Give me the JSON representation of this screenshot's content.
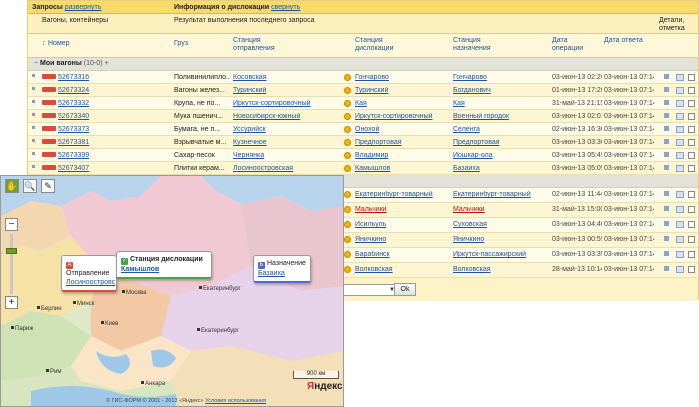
{
  "topbar": {
    "queries_label": "Запросы",
    "expand_link": "развернуть",
    "dislocation_label": "Информация о дислокации",
    "collapse_link": "свернуть"
  },
  "subbar": {
    "left_text": "Вагоны, контейнеры",
    "mid_text": "Результат выполнения последнего запроса",
    "right_text": "Детали, отметка"
  },
  "columns": {
    "number": "Номер",
    "cargo": "Груз",
    "departure_station": "Станция отправления",
    "dislocation_station": "Станция дислокации",
    "destination_station": "Станция назначения",
    "operation_date": "Дата операции",
    "answer_date": "Дата ответа"
  },
  "group": {
    "name": "Мои вагоны",
    "count": "(10-0)",
    "plus": "+"
  },
  "rows": [
    {
      "num": "52673316",
      "cargo": "Поливинилипло...",
      "from": "Косовская",
      "disl": "Гончарово",
      "to": "Гончарово",
      "op": "03-июн-13 02:26",
      "ans": "03-июн-13 07:14"
    },
    {
      "num": "52673324",
      "cargo": "Вагоны желез...",
      "from": "Туринский",
      "disl": "Туринский",
      "to": "Богданович",
      "op": "01-июн-13 17:20",
      "ans": "03-июн-13 07:14"
    },
    {
      "num": "52673332",
      "cargo": "Крупа, не по...",
      "from": "Иркутск-сортировочный",
      "disl": "Кая",
      "to": "Кая",
      "op": "31-май-13 21:15",
      "ans": "03-июн-13 07:14"
    },
    {
      "num": "52673340",
      "cargo": "Мука пшенич...",
      "from": "Новосибирск-южный",
      "disl": "Иркутск-сортировочный",
      "to": "Военный городок",
      "op": "03-июн-13 02:01",
      "ans": "03-июн-13 07:14"
    },
    {
      "num": "52673373",
      "cargo": "Бумага, не п...",
      "from": "Уссурийск",
      "disl": "Онохой",
      "to": "Селенга",
      "op": "02-июн-13 16:36",
      "ans": "03-июн-13 07:14"
    },
    {
      "num": "52673381",
      "cargo": "Взрывчатые м...",
      "from": "Кузнечное",
      "disl": "Предпортовая",
      "to": "Предпортовая",
      "op": "03-июн-13 03:36",
      "ans": "03-июн-13 07:14"
    },
    {
      "num": "52673399",
      "cargo": "Сахар-песок",
      "from": "Чернянка",
      "disl": "Владимир",
      "to": "Йошкар-ола",
      "op": "03-июн-13 05:49",
      "ans": "03-июн-13 07:14"
    },
    {
      "num": "52673407",
      "cargo": "Плитки керам...",
      "from": "Лосиноостровская",
      "disl": "Камышлов",
      "to": "Базаиха",
      "op": "03-июн-13 05:09",
      "ans": "03-июн-13 07:14"
    }
  ],
  "rows2": [
    {
      "disl": "Екатеринбург-товарный",
      "to": "Екатеринбург-товарный",
      "op": "02-июн-13 11:44",
      "ans": "03-июн-13 07:14",
      "red": false
    },
    {
      "disl": "Мальчики",
      "to": "Мальчики",
      "op": "31-май-13 15:00",
      "ans": "03-июн-13 07:14",
      "red": true
    },
    {
      "disl": "Исильуль",
      "to": "Суховская",
      "op": "03-июн-13 04:40",
      "ans": "03-июн-13 07:14",
      "red": false
    },
    {
      "disl": "Яничкино",
      "to": "Яничкино",
      "op": "03-июн-13 00:59",
      "ans": "03-июн-13 07:14",
      "red": false
    },
    {
      "disl": "Барабинск",
      "to": "Иркутск-пассажирский",
      "op": "03-июн-13 03:39",
      "ans": "03-июн-13 07:14",
      "red": false
    },
    {
      "disl": "Волковская",
      "to": "Волковская",
      "op": "28-май-13 10:14",
      "ans": "03-июн-13 07:14",
      "red": false
    }
  ],
  "bottom": {
    "ok_label": "Ok"
  },
  "map": {
    "balloon_from_title": "Отправление",
    "balloon_from_value": "Лосиноостровс",
    "balloon_disl_title": "Станция дислокации",
    "balloon_disl_value": "Камышлов",
    "balloon_to_title": "Назначение",
    "balloon_to_value": "Базаиха",
    "badge_a": "A",
    "badge_b": "Б",
    "cities": [
      "Москва",
      "Екатеринбург",
      "Екатеринбург",
      "Киев",
      "Минск",
      "Париж",
      "Рим",
      "Анкара",
      "Берлин"
    ],
    "scale": "900 км",
    "logo_a": "Я",
    "logo_b": "ндекс",
    "copyright": "© ГИС-ФОРМ © 2001 - 2013 «Яндекс»",
    "terms": "Условия использования"
  },
  "colors": {
    "accent": "#f6da6a",
    "panel": "#fdf3c6",
    "link": "#1d55a6",
    "wagon": "#d94b3b",
    "marker": "#f4b400"
  }
}
